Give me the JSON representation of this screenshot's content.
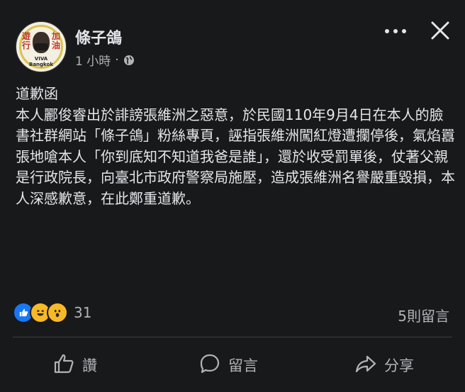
{
  "post": {
    "author": "條子鴿",
    "time": "1 小時",
    "time_separator": "·",
    "avatar_text": {
      "left": "遊行",
      "right": "加油",
      "bottom": "VIVA Bangkok"
    },
    "body": "道歉函\n本人酈俊睿出於誹謗張維洲之惡意，於民國110年9月4日在本人的臉書社群網站「條子鴿」粉絲專頁，誣指張維洲闖紅燈遭攔停後，氣焰囂張地嗆本人「你到底知不知道我爸是誰」，還於收受罰單後，仗著父親是行政院長，向臺北市政府警察局施壓，造成張維洲名譽嚴重毀損，本人深感歉意，在此鄭重道歉。",
    "reaction_count": "31",
    "comments_label": "5則留言"
  },
  "actions": {
    "like": "讚",
    "comment": "留言",
    "share": "分享"
  },
  "icons": [
    "more-options-icon",
    "close-icon",
    "globe-icon",
    "like-reaction-icon",
    "haha-reaction-icon",
    "wow-reaction-icon",
    "thumbs-up-icon",
    "comment-bubble-icon",
    "share-arrow-icon"
  ],
  "colors": {
    "background": "#18191a",
    "text": "#e4e6eb",
    "secondary": "#b0b3b8",
    "like_blue": "#1877f2",
    "reaction_yellow": "#f7b928"
  }
}
